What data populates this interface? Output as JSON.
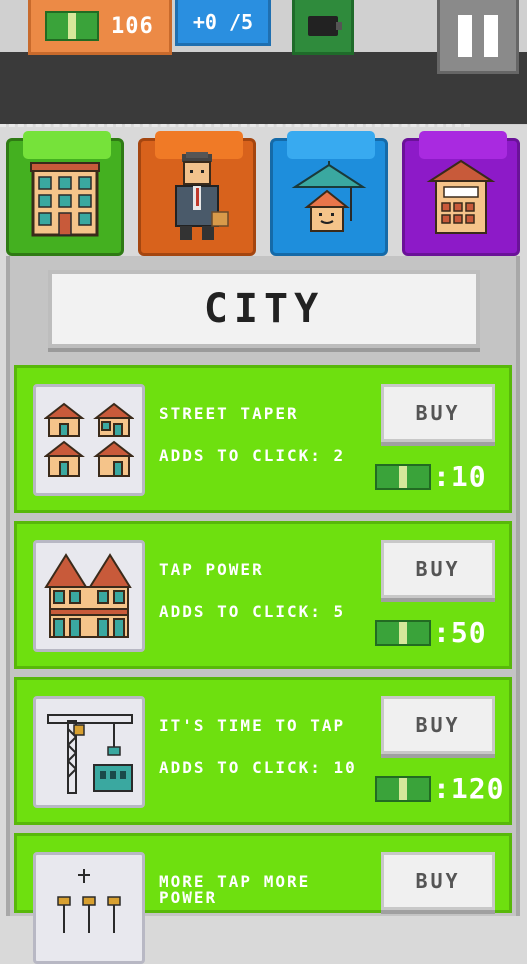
{
  "hud": {
    "money": "106",
    "rate": "+0 /5",
    "icons": {
      "money": "cash-icon",
      "wallet": "wallet-icon",
      "pause": "pause-icon"
    }
  },
  "tabs": [
    {
      "id": "city",
      "icon": "building-icon",
      "color": "#44b020"
    },
    {
      "id": "staff",
      "icon": "businessman-icon",
      "color": "#d8621c"
    },
    {
      "id": "resort",
      "icon": "umbrella-house-icon",
      "color": "#1e8edc"
    },
    {
      "id": "bank",
      "icon": "bank-building-icon",
      "color": "#8d1ac8"
    }
  ],
  "section_title": "CITY",
  "upgrades": [
    {
      "name": "STREET TAPER",
      "desc": "ADDS TO CLICK: 2",
      "buy": "BUY",
      "price": ":10",
      "icon": "houses-icon"
    },
    {
      "name": "TAP POWER",
      "desc": "ADDS TO CLICK: 5",
      "buy": "BUY",
      "price": ":50",
      "icon": "townhouses-icon"
    },
    {
      "name": "IT'S TIME TO TAP",
      "desc": "ADDS TO CLICK: 10",
      "buy": "BUY",
      "price": ":120",
      "icon": "crane-icon"
    },
    {
      "name": "MORE TAP MORE POWER",
      "desc": "",
      "buy": "BUY",
      "price": "",
      "icon": "power-lines-icon"
    }
  ],
  "colors": {
    "card": "#6ee00f",
    "accent_blue": "#2a8fe0",
    "accent_orange": "#ec8a46"
  }
}
